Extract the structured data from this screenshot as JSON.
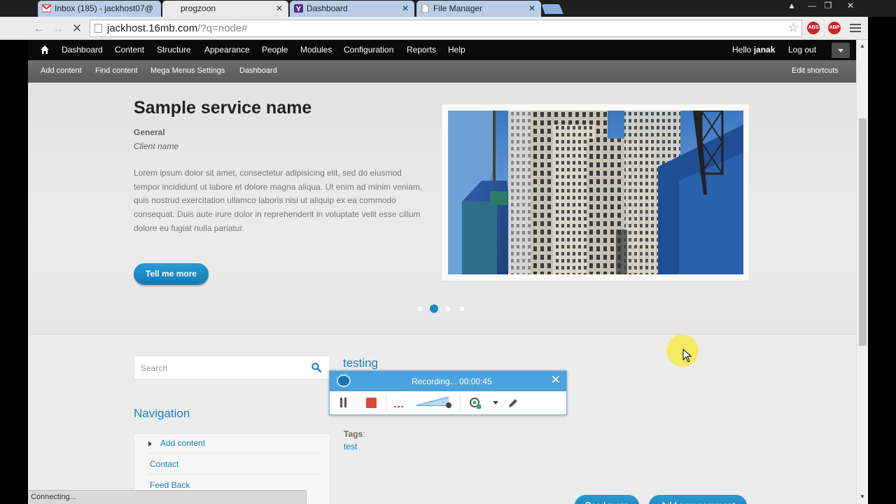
{
  "browser": {
    "tabs": [
      {
        "label": "Inbox (185) - jackhost07@",
        "icon": "gmail-icon"
      },
      {
        "label": "progzoon",
        "icon": "none"
      },
      {
        "label": "Dashboard",
        "icon": "yahoo-icon"
      },
      {
        "label": "File Manager",
        "icon": "page-icon"
      }
    ],
    "tab_close": "✕",
    "window_controls": {
      "user": "▲",
      "minimize": "—",
      "maximize": "❐",
      "close": "✕"
    },
    "url_host": "jackhost.16mb.com",
    "url_path": "/?q=node#",
    "extensions": [
      "ABS",
      "ABP"
    ],
    "status_text": "Connecting..."
  },
  "admin_menu": {
    "items": [
      "Dashboard",
      "Content",
      "Structure",
      "Appearance",
      "People",
      "Modules",
      "Configuration",
      "Reports",
      "Help"
    ],
    "hello_prefix": "Hello",
    "username": "janak",
    "logout": "Log out"
  },
  "shortcuts": {
    "items": [
      "Add content",
      "Find content",
      "Mega Menus Settings",
      "Dashboard"
    ],
    "edit": "Edit shortcuts"
  },
  "hero": {
    "title": "Sample service name",
    "category": "General",
    "client": "Client name",
    "body": "Lorem ipsum dolor sit amet, consectetur adipisicing elit, sed do eiusmod tempor incididunt ut labore et dolore magna aliqua. Ut enim ad minim veniam, quis nostrud exercitation ullamco laboris nisi ut aliquip ex ea commodo consequat. Duis aute irure dolor in reprehenderit in voluptate velit esse cillum dolore eu fugiat nulla pariatur.",
    "button": "Tell me more",
    "slide_count": 4,
    "active_slide": 2
  },
  "sidebar": {
    "search_placeholder": "Search",
    "nav_title": "Navigation",
    "nav_items": [
      "Add content",
      "Contact",
      "Feed Back"
    ]
  },
  "article": {
    "title": "testing",
    "tags_label": "Tags",
    "tags": [
      "test"
    ],
    "read_more": "Read more",
    "add_comment": "Add new comment"
  },
  "recorder": {
    "status": "Recording... 00:00:45"
  },
  "colors": {
    "link": "#1b7fb9",
    "button": "#1787c2",
    "recorder_header": "#4aa3de",
    "stop": "#d9473c"
  }
}
